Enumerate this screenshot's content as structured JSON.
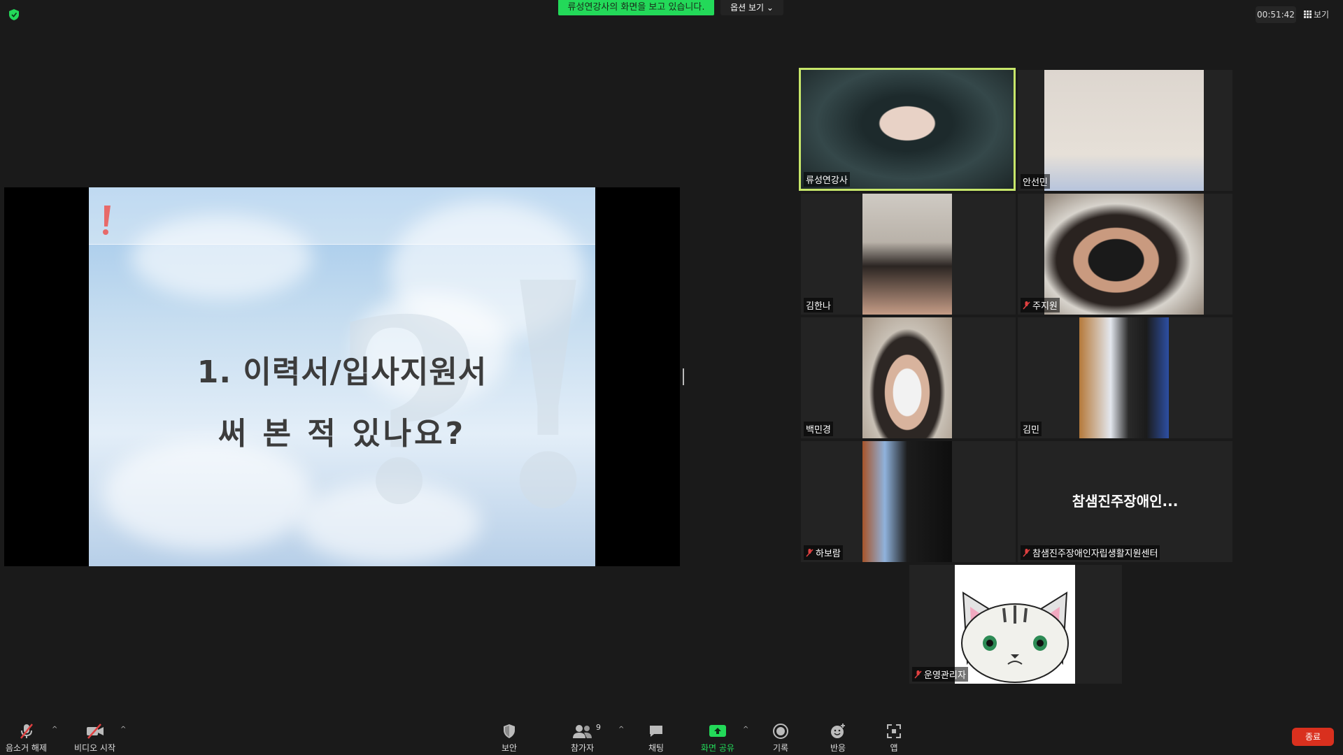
{
  "top": {
    "share_banner": "류성연강사의 화면을 보고 있습니다.",
    "view_options": "옵션 보기",
    "timer": "00:51:42",
    "view_button": "보기",
    "accent_color": "#23d959"
  },
  "slide": {
    "title": "1. 이력서/입사지원서",
    "subtitle": "써 본 적 있나요?"
  },
  "participants": [
    {
      "name": "류성연강사",
      "muted": false,
      "active": true
    },
    {
      "name": "안선민",
      "muted": false
    },
    {
      "name": "김한나",
      "muted": false
    },
    {
      "name": "주지원",
      "muted": true
    },
    {
      "name": "백민경",
      "muted": false
    },
    {
      "name": "김민",
      "muted": false
    },
    {
      "name": "하보람",
      "muted": true
    },
    {
      "name": "참샘진주장애인자립생활지원센터",
      "short": "참샘진주장애인...",
      "muted": true
    },
    {
      "name": "운영관리자",
      "muted": true
    }
  ],
  "toolbar": {
    "unmute": "음소거 해제",
    "start_video": "비디오 시작",
    "security": "보안",
    "participants": "참가자",
    "participant_count": "9",
    "chat": "채팅",
    "share_screen": "화면 공유",
    "record": "기록",
    "reactions": "반응",
    "apps": "앱",
    "end": "종료",
    "end_color": "#d9301e"
  }
}
